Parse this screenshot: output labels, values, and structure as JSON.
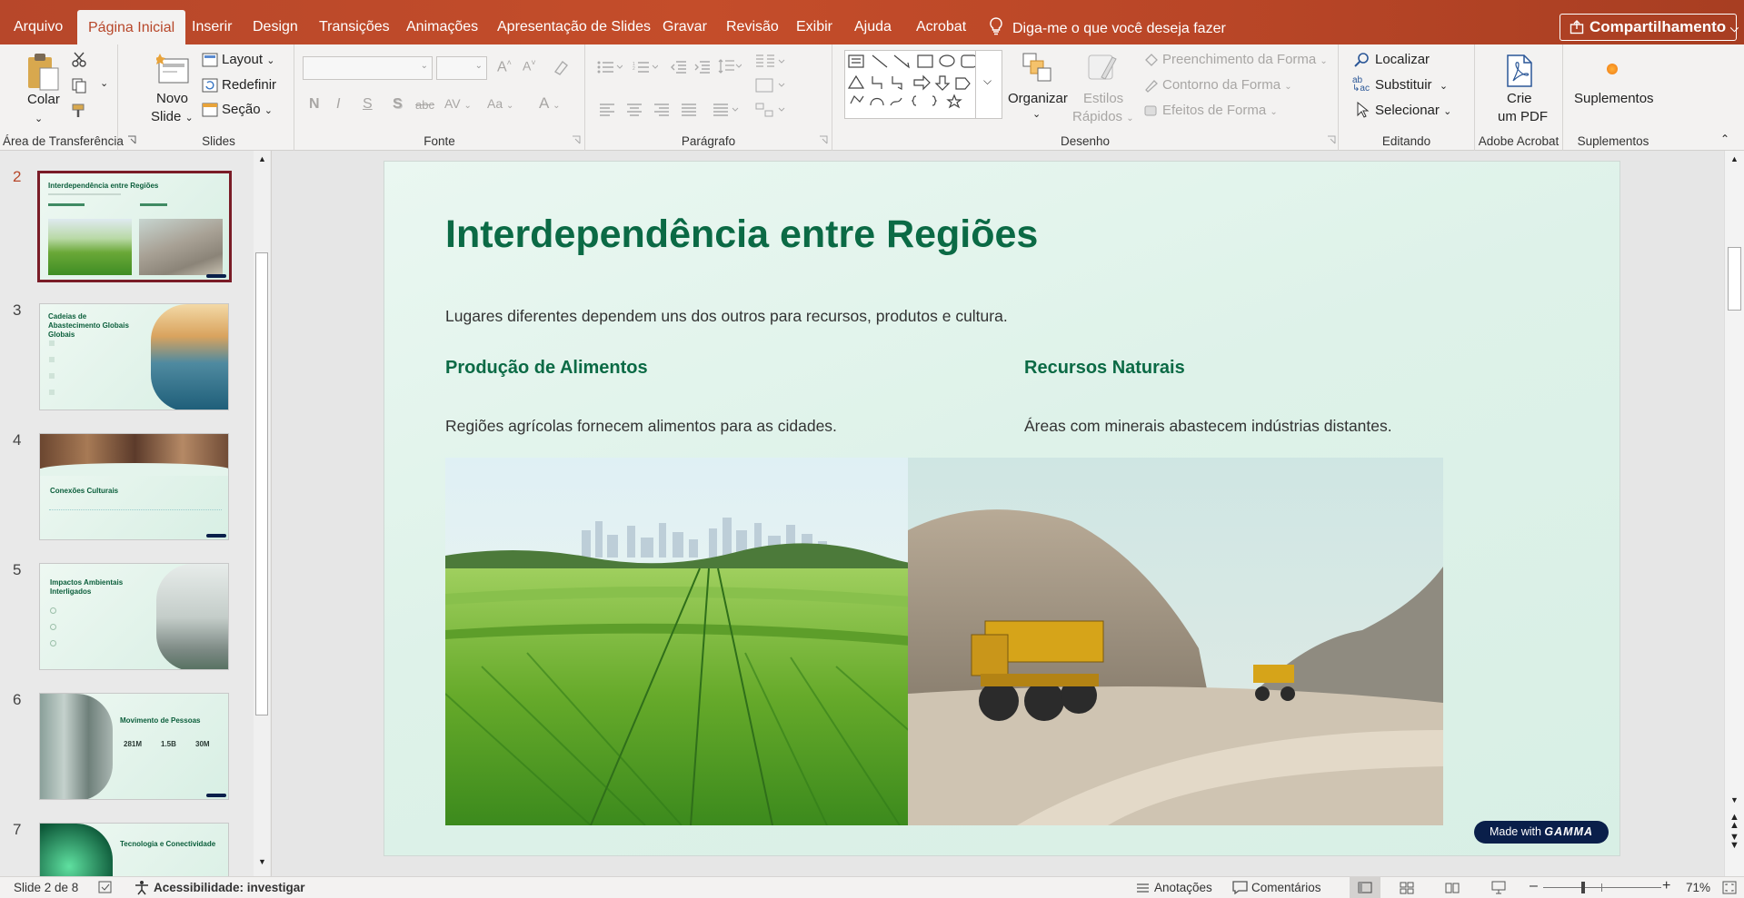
{
  "menu": {
    "tabs": [
      "Arquivo",
      "Página Inicial",
      "Inserir",
      "Design",
      "Transições",
      "Animações",
      "Apresentação de Slides",
      "Gravar",
      "Revisão",
      "Exibir",
      "Ajuda",
      "Acrobat"
    ],
    "active_tab": "Página Inicial",
    "tell_me": "Diga-me o que você deseja fazer",
    "share": "Compartilhamento"
  },
  "ribbon": {
    "clipboard": {
      "label": "Área de Transferência",
      "paste": "Colar"
    },
    "slides": {
      "label": "Slides",
      "new_slide_1": "Novo",
      "new_slide_2": "Slide",
      "layout": "Layout",
      "reset": "Redefinir",
      "section": "Seção"
    },
    "font": {
      "label": "Fonte",
      "bold": "N",
      "italic": "I",
      "underline": "S",
      "shadow": "S",
      "strike": "abc",
      "spacing": "AV",
      "case": "Aa",
      "color": "A"
    },
    "paragraph": {
      "label": "Parágrafo"
    },
    "drawing": {
      "label": "Desenho",
      "arrange": "Organizar",
      "quick_styles_1": "Estilos",
      "quick_styles_2": "Rápidos",
      "fill": "Preenchimento da Forma",
      "outline": "Contorno da Forma",
      "effects": "Efeitos de Forma"
    },
    "editing": {
      "label": "Editando",
      "find": "Localizar",
      "replace": "Substituir",
      "select": "Selecionar"
    },
    "acrobat": {
      "label": "Adobe Acrobat",
      "create_1": "Crie",
      "create_2": "um PDF"
    },
    "addins": {
      "label": "Suplementos",
      "button": "Suplementos"
    }
  },
  "thumbnails": [
    {
      "num": "2",
      "title": "Interdependência entre Regiões",
      "selected": true
    },
    {
      "num": "3",
      "title": "Cadeias de Abastecimento Globais Globais"
    },
    {
      "num": "4",
      "title": "Conexões Culturais"
    },
    {
      "num": "5",
      "title": "Impactos Ambientais Interligados"
    },
    {
      "num": "6",
      "title": "Movimento de Pessoas",
      "stats": [
        "281M",
        "1.5B",
        "30M"
      ]
    },
    {
      "num": "7",
      "title": "Tecnologia e Conectividade"
    }
  ],
  "slide": {
    "title": "Interdependência entre Regiões",
    "subtitle": "Lugares diferentes dependem uns dos outros para recursos, produtos e cultura.",
    "left_heading": "Produção de Alimentos",
    "left_text": "Regiões agrícolas fornecem alimentos para as cidades.",
    "right_heading": "Recursos Naturais",
    "right_text": "Áreas com minerais abastecem indústrias distantes.",
    "badge_prefix": "Made with",
    "badge_brand": "GAMMA"
  },
  "status": {
    "slide_info": "Slide 2 de 8",
    "accessibility": "Acessibilidade: investigar",
    "notes": "Anotações",
    "comments": "Comentários",
    "zoom": "71%"
  }
}
